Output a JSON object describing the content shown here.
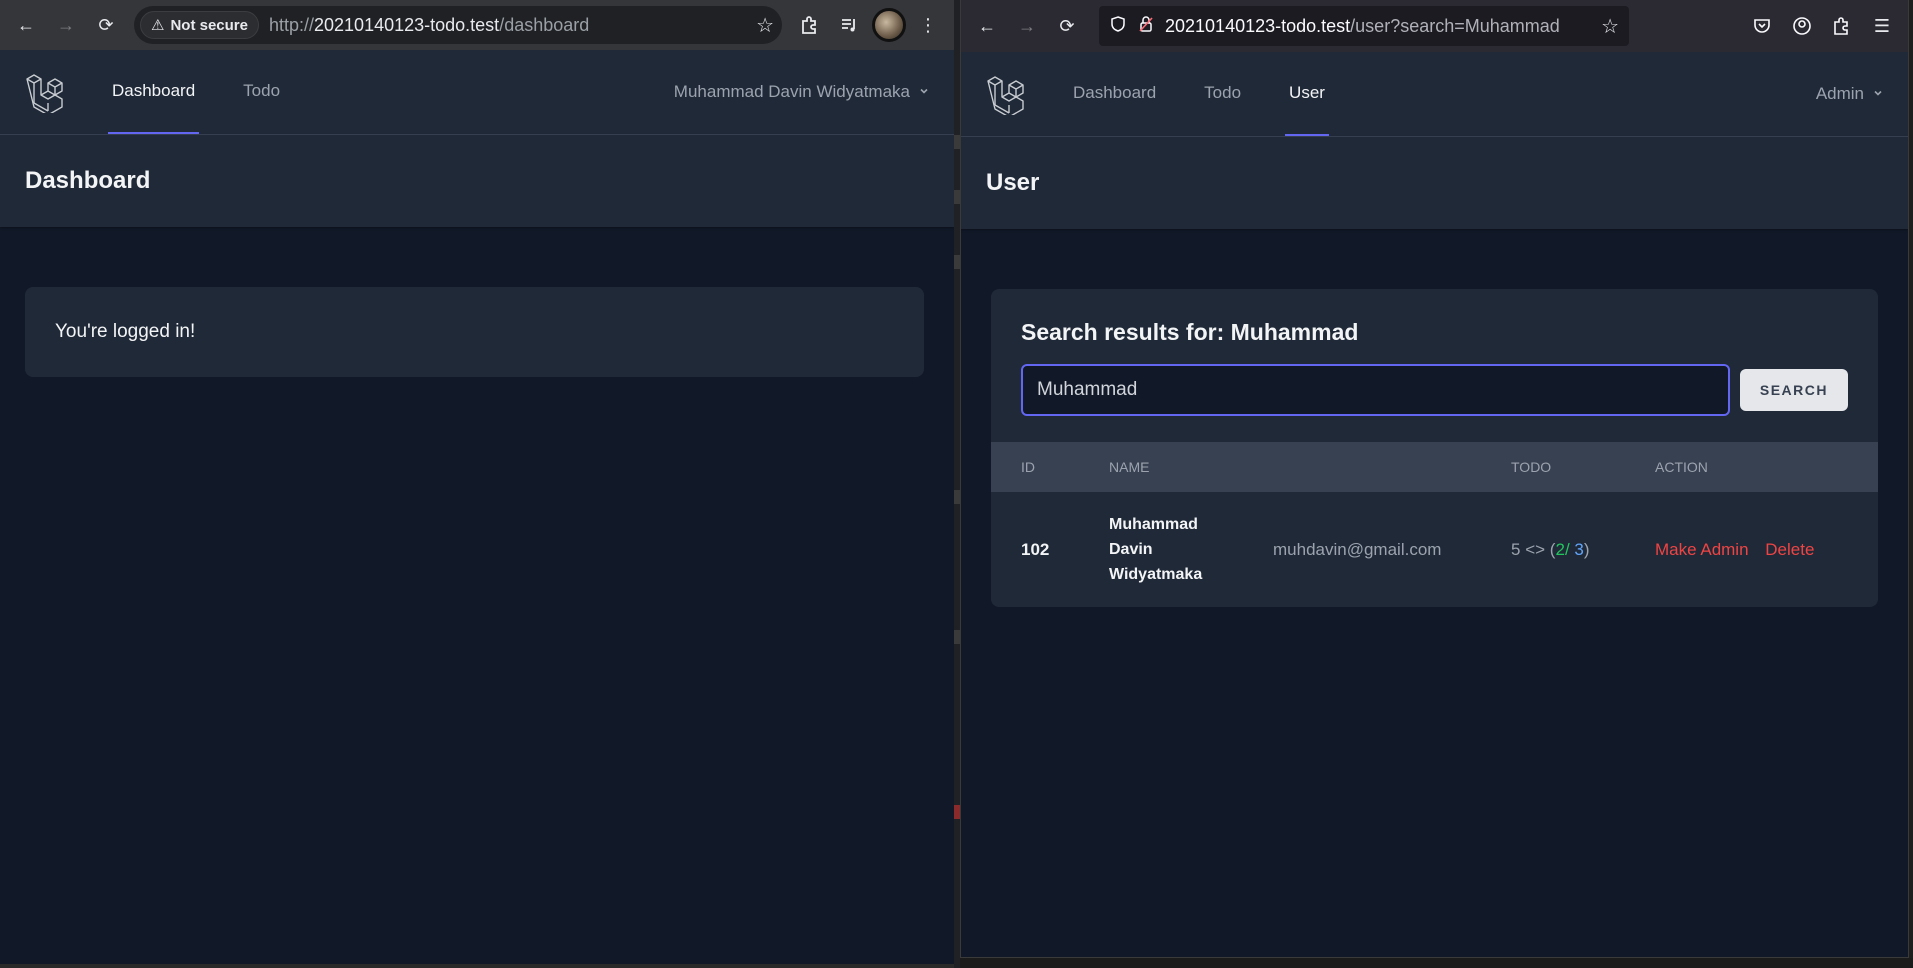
{
  "left": {
    "browser": {
      "security_label": "Not secure",
      "url_scheme": "http://",
      "url_host": "20210140123-todo.test",
      "url_path": "/dashboard"
    },
    "nav": {
      "links": [
        "Dashboard",
        "Todo"
      ],
      "user_name": "Muhammad Davin Widyatmaka"
    },
    "header_title": "Dashboard",
    "message": "You're logged in!"
  },
  "right": {
    "browser": {
      "url_host": "20210140123-todo.test",
      "url_rest": "/user?search=Muhammad"
    },
    "nav": {
      "links": [
        "Dashboard",
        "Todo",
        "User"
      ],
      "user_name": "Admin"
    },
    "header_title": "User",
    "search": {
      "title": "Search results for: Muhammad",
      "value": "Muhammad",
      "button": "SEARCH"
    },
    "table": {
      "headers": [
        "ID",
        "NAME",
        "",
        "TODO",
        "ACTION"
      ],
      "rows": [
        {
          "id": "102",
          "name_line1": "Muhammad",
          "name_line2": "Davin",
          "name_line3": "Widyatmaka",
          "email": "muhdavin@gmail.com",
          "todo_total": "5",
          "todo_sep": "<>",
          "todo_open": "(",
          "todo_done": "2",
          "todo_slash": "/",
          "todo_pending": "3",
          "todo_close": ")",
          "action_make_admin": "Make Admin",
          "action_delete": "Delete"
        }
      ]
    }
  },
  "colors": {
    "bg": "#111827",
    "panel": "#1f2937",
    "accent": "#6366f1",
    "danger": "#ef4444",
    "done": "#22c55e",
    "pending": "#60a5fa"
  }
}
